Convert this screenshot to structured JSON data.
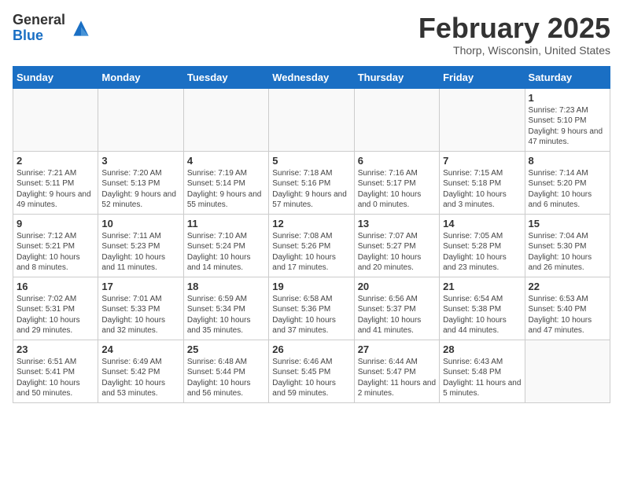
{
  "header": {
    "logo_general": "General",
    "logo_blue": "Blue",
    "month_title": "February 2025",
    "location": "Thorp, Wisconsin, United States"
  },
  "weekdays": [
    "Sunday",
    "Monday",
    "Tuesday",
    "Wednesday",
    "Thursday",
    "Friday",
    "Saturday"
  ],
  "weeks": [
    [
      {
        "day": "",
        "info": ""
      },
      {
        "day": "",
        "info": ""
      },
      {
        "day": "",
        "info": ""
      },
      {
        "day": "",
        "info": ""
      },
      {
        "day": "",
        "info": ""
      },
      {
        "day": "",
        "info": ""
      },
      {
        "day": "1",
        "info": "Sunrise: 7:23 AM\nSunset: 5:10 PM\nDaylight: 9 hours and 47 minutes."
      }
    ],
    [
      {
        "day": "2",
        "info": "Sunrise: 7:21 AM\nSunset: 5:11 PM\nDaylight: 9 hours and 49 minutes."
      },
      {
        "day": "3",
        "info": "Sunrise: 7:20 AM\nSunset: 5:13 PM\nDaylight: 9 hours and 52 minutes."
      },
      {
        "day": "4",
        "info": "Sunrise: 7:19 AM\nSunset: 5:14 PM\nDaylight: 9 hours and 55 minutes."
      },
      {
        "day": "5",
        "info": "Sunrise: 7:18 AM\nSunset: 5:16 PM\nDaylight: 9 hours and 57 minutes."
      },
      {
        "day": "6",
        "info": "Sunrise: 7:16 AM\nSunset: 5:17 PM\nDaylight: 10 hours and 0 minutes."
      },
      {
        "day": "7",
        "info": "Sunrise: 7:15 AM\nSunset: 5:18 PM\nDaylight: 10 hours and 3 minutes."
      },
      {
        "day": "8",
        "info": "Sunrise: 7:14 AM\nSunset: 5:20 PM\nDaylight: 10 hours and 6 minutes."
      }
    ],
    [
      {
        "day": "9",
        "info": "Sunrise: 7:12 AM\nSunset: 5:21 PM\nDaylight: 10 hours and 8 minutes."
      },
      {
        "day": "10",
        "info": "Sunrise: 7:11 AM\nSunset: 5:23 PM\nDaylight: 10 hours and 11 minutes."
      },
      {
        "day": "11",
        "info": "Sunrise: 7:10 AM\nSunset: 5:24 PM\nDaylight: 10 hours and 14 minutes."
      },
      {
        "day": "12",
        "info": "Sunrise: 7:08 AM\nSunset: 5:26 PM\nDaylight: 10 hours and 17 minutes."
      },
      {
        "day": "13",
        "info": "Sunrise: 7:07 AM\nSunset: 5:27 PM\nDaylight: 10 hours and 20 minutes."
      },
      {
        "day": "14",
        "info": "Sunrise: 7:05 AM\nSunset: 5:28 PM\nDaylight: 10 hours and 23 minutes."
      },
      {
        "day": "15",
        "info": "Sunrise: 7:04 AM\nSunset: 5:30 PM\nDaylight: 10 hours and 26 minutes."
      }
    ],
    [
      {
        "day": "16",
        "info": "Sunrise: 7:02 AM\nSunset: 5:31 PM\nDaylight: 10 hours and 29 minutes."
      },
      {
        "day": "17",
        "info": "Sunrise: 7:01 AM\nSunset: 5:33 PM\nDaylight: 10 hours and 32 minutes."
      },
      {
        "day": "18",
        "info": "Sunrise: 6:59 AM\nSunset: 5:34 PM\nDaylight: 10 hours and 35 minutes."
      },
      {
        "day": "19",
        "info": "Sunrise: 6:58 AM\nSunset: 5:36 PM\nDaylight: 10 hours and 37 minutes."
      },
      {
        "day": "20",
        "info": "Sunrise: 6:56 AM\nSunset: 5:37 PM\nDaylight: 10 hours and 41 minutes."
      },
      {
        "day": "21",
        "info": "Sunrise: 6:54 AM\nSunset: 5:38 PM\nDaylight: 10 hours and 44 minutes."
      },
      {
        "day": "22",
        "info": "Sunrise: 6:53 AM\nSunset: 5:40 PM\nDaylight: 10 hours and 47 minutes."
      }
    ],
    [
      {
        "day": "23",
        "info": "Sunrise: 6:51 AM\nSunset: 5:41 PM\nDaylight: 10 hours and 50 minutes."
      },
      {
        "day": "24",
        "info": "Sunrise: 6:49 AM\nSunset: 5:42 PM\nDaylight: 10 hours and 53 minutes."
      },
      {
        "day": "25",
        "info": "Sunrise: 6:48 AM\nSunset: 5:44 PM\nDaylight: 10 hours and 56 minutes."
      },
      {
        "day": "26",
        "info": "Sunrise: 6:46 AM\nSunset: 5:45 PM\nDaylight: 10 hours and 59 minutes."
      },
      {
        "day": "27",
        "info": "Sunrise: 6:44 AM\nSunset: 5:47 PM\nDaylight: 11 hours and 2 minutes."
      },
      {
        "day": "28",
        "info": "Sunrise: 6:43 AM\nSunset: 5:48 PM\nDaylight: 11 hours and 5 minutes."
      },
      {
        "day": "",
        "info": ""
      }
    ]
  ]
}
